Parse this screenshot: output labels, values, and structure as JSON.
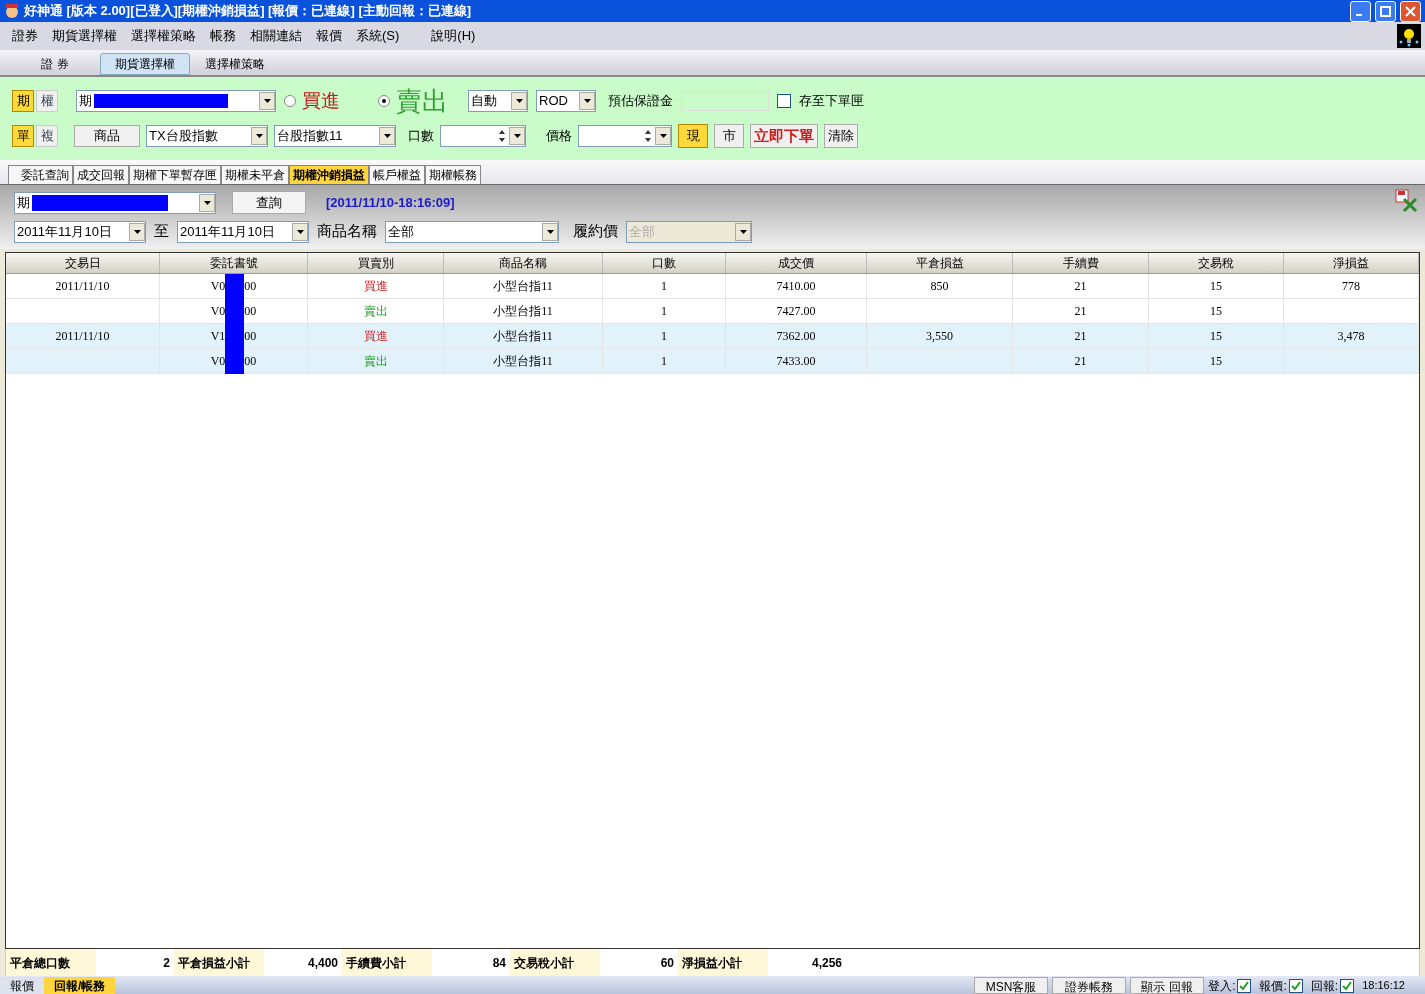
{
  "window": {
    "title": "好神通 [版本 2.00][已登入][期權沖銷損益] [報價：已連線] [主動回報：已連線]"
  },
  "menu": [
    "證券",
    "期貨選擇權",
    "選擇權策略",
    "帳務",
    "相關連結",
    "報價",
    "系統(S)",
    "說明(H)"
  ],
  "top_tabs": [
    {
      "label": "證 券",
      "selected": false
    },
    {
      "label": "期貨選擇權",
      "selected": true
    },
    {
      "label": "選擇權策略",
      "selected": false
    }
  ],
  "order_form": {
    "market_toggle": [
      {
        "label": "期",
        "selected": true
      },
      {
        "label": "權",
        "selected": false
      }
    ],
    "account": "期",
    "sides": [
      {
        "label": "買進",
        "kind": "buy",
        "selected": false
      },
      {
        "label": "賣出",
        "kind": "sell",
        "selected": true
      }
    ],
    "open_close": "自動",
    "time_in_force": "ROD",
    "margin_label": "預估保證金",
    "save_label": "存至下單匣",
    "save_checked": false,
    "mode_toggle": [
      {
        "label": "單",
        "selected": true
      },
      {
        "label": "複",
        "selected": false
      }
    ],
    "product_button": "商品",
    "product": "TX台股指數",
    "contract": "台股指數11",
    "qty_label": "口數",
    "price_label": "價格",
    "price_type": [
      {
        "label": "現",
        "selected": true
      },
      {
        "label": "市",
        "selected": false
      }
    ],
    "submit": "立即下單",
    "clear": "清除"
  },
  "sub_tabs": [
    {
      "label": "委託查詢",
      "selected": false
    },
    {
      "label": "成交回報",
      "selected": false
    },
    {
      "label": "期權下單暫存匣",
      "selected": false
    },
    {
      "label": "期權未平倉",
      "selected": false
    },
    {
      "label": "期權沖銷損益",
      "selected": true
    },
    {
      "label": "帳戶權益",
      "selected": false
    },
    {
      "label": "期權帳務",
      "selected": false
    }
  ],
  "filter": {
    "account": "期",
    "query": "查詢",
    "timestamp": "[2011/11/10-18:16:09]",
    "date_from": "2011年11月10日",
    "to_label": "至",
    "date_to": "2011年11月10日",
    "product_label": "商品名稱",
    "product": "全部",
    "strike_label": "履約價",
    "strike": "全部",
    "strike_disabled": true
  },
  "table": {
    "columns": [
      "交易日",
      "委託書號",
      "買賣別",
      "商品名稱",
      "口數",
      "成交價",
      "平倉損益",
      "手續費",
      "交易稅",
      "淨損益"
    ],
    "rows": [
      {
        "highlighted": false,
        "date": "2011/11/10",
        "order_prefix": "V0",
        "order_suffix": "00",
        "side": "買進",
        "kind": "buy",
        "product": "小型台指11",
        "qty": "1",
        "price": "7410.00",
        "close_pl": "850",
        "fee": "21",
        "tax": "15",
        "net": "778"
      },
      {
        "highlighted": false,
        "date": "",
        "order_prefix": "V0",
        "order_suffix": "00",
        "side": "賣出",
        "kind": "sell",
        "product": "小型台指11",
        "qty": "1",
        "price": "7427.00",
        "close_pl": "",
        "fee": "21",
        "tax": "15",
        "net": ""
      },
      {
        "highlighted": true,
        "date": "2011/11/10",
        "order_prefix": "V1",
        "order_suffix": "00",
        "side": "買進",
        "kind": "buy",
        "product": "小型台指11",
        "qty": "1",
        "price": "7362.00",
        "close_pl": "3,550",
        "fee": "21",
        "tax": "15",
        "net": "3,478"
      },
      {
        "highlighted": true,
        "date": "",
        "order_prefix": "V0",
        "order_suffix": "00",
        "side": "賣出",
        "kind": "sell",
        "product": "小型台指11",
        "qty": "1",
        "price": "7433.00",
        "close_pl": "",
        "fee": "21",
        "tax": "15",
        "net": ""
      }
    ]
  },
  "summary": [
    {
      "label": "平倉總口數",
      "value": "2"
    },
    {
      "label": "平倉損益小計",
      "value": "4,400"
    },
    {
      "label": "手續費小計",
      "value": "84"
    },
    {
      "label": "交易稅小計",
      "value": "60"
    },
    {
      "label": "淨損益小計",
      "value": "4,256"
    }
  ],
  "bottom_tabs": [
    {
      "label": "報價",
      "selected": false
    },
    {
      "label": "回報/帳務",
      "selected": true
    }
  ],
  "status_buttons": [
    "MSN客服",
    "證券帳務",
    "顯示 回報"
  ],
  "indicators": [
    {
      "label": "登入:",
      "checked": true
    },
    {
      "label": "報價:",
      "checked": true
    },
    {
      "label": "回報:",
      "checked": true
    }
  ],
  "clock": "18:16:12"
}
